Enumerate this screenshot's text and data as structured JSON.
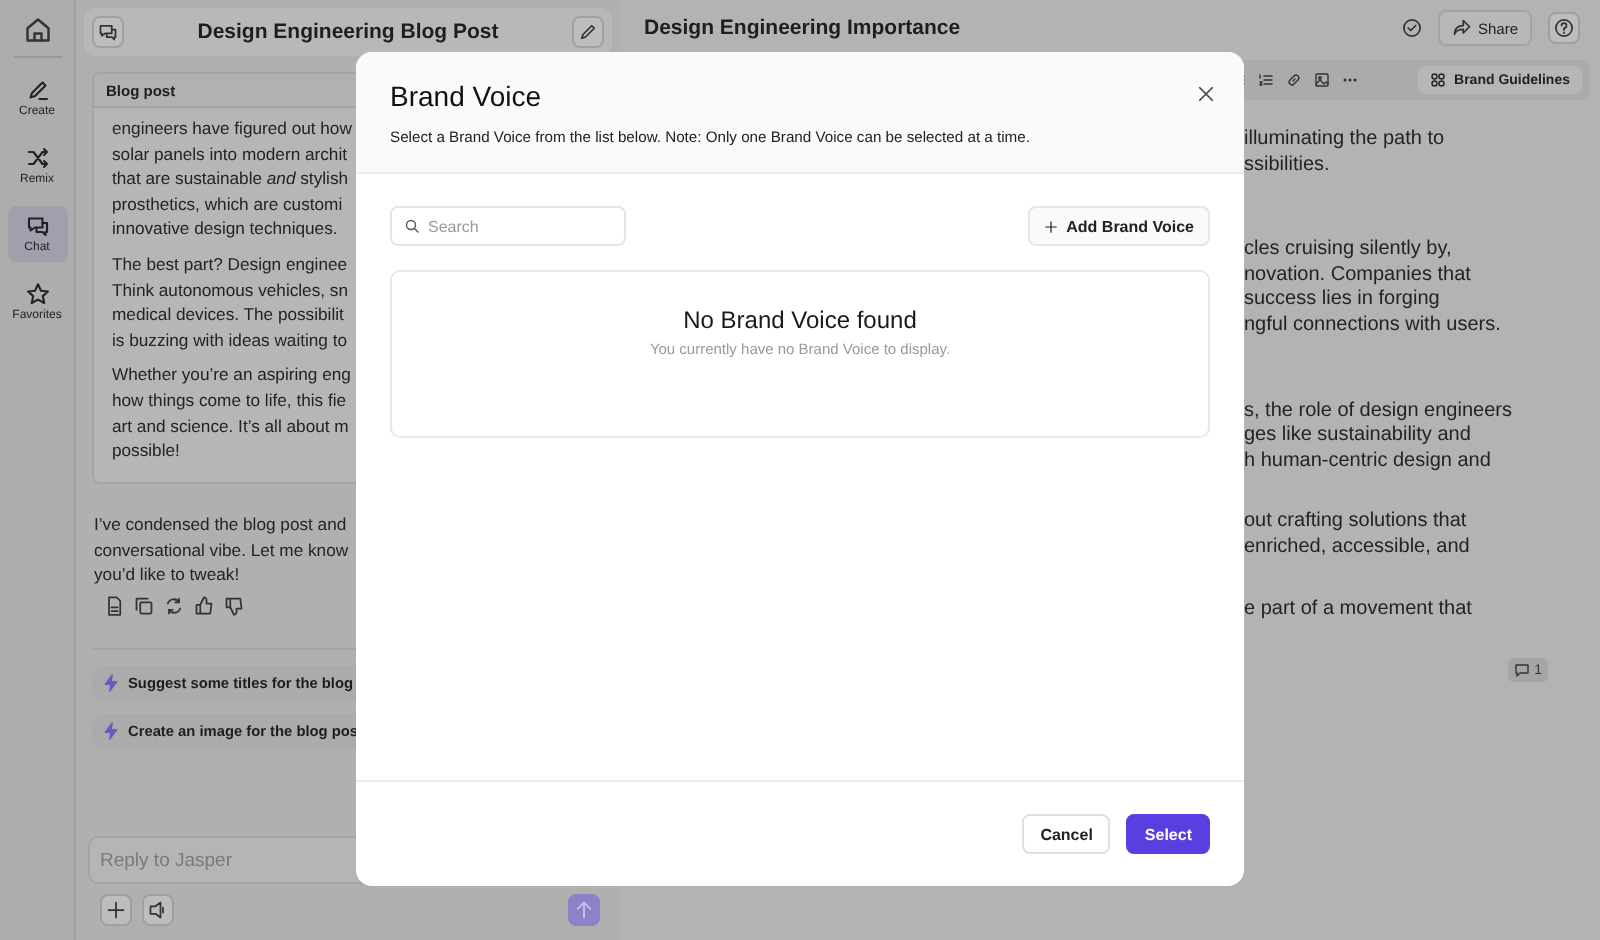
{
  "sidebar": {
    "items": [
      {
        "label": "Create",
        "selected": false
      },
      {
        "label": "Remix",
        "selected": false
      },
      {
        "label": "Chat",
        "selected": true
      },
      {
        "label": "Favorites",
        "selected": false
      }
    ]
  },
  "chat": {
    "title": "Design Engineering Blog Post",
    "card_label": "Blog post",
    "card_paragraphs": [
      [
        "engineers have figured out how",
        "solar panels into modern archit",
        "that are sustainable *and* stylish",
        "prosthetics, which are customi",
        "innovative design techniques."
      ],
      [
        "The best part? Design enginee",
        "Think autonomous vehicles, sn",
        "medical devices. The possibilit",
        "is buzzing with ideas waiting to"
      ],
      [
        "Whether you’re an aspiring eng",
        "how things come to life, this fie",
        "art and science. It’s all about m",
        "possible!"
      ]
    ],
    "reply_lines": [
      "I’ve condensed the blog post and",
      "conversational vibe. Let me know",
      "you’d like to tweak!"
    ],
    "suggestions": [
      "Suggest some titles for the blog",
      "Create an image for the blog pos"
    ],
    "input": {
      "placeholder": "Reply to Jasper"
    }
  },
  "document": {
    "title": "Design Engineering Importance",
    "share": "Share",
    "brand_guidelines": "Brand Guidelines",
    "paragraphs": [
      [
        "illuminating the path to",
        "ssibilities."
      ],
      [
        "cles cruising silently by,",
        "novation. Companies that",
        "success lies in forging",
        "ngful connections with users."
      ],
      [
        "s, the role of design engineers",
        "ges like sustainability and",
        "h human-centric design and"
      ],
      [
        "out crafting solutions that",
        "enriched, accessible, and"
      ],
      [
        "e part of a movement that"
      ]
    ],
    "comment_count": "1"
  },
  "modal": {
    "title": "Brand Voice",
    "subtitle": "Select a Brand Voice from the list below. Note: Only one Brand Voice can be selected at a time.",
    "search": {
      "placeholder": "Search"
    },
    "add_button": "Add Brand Voice",
    "empty_title": "No Brand Voice found",
    "empty_message": "You currently have no Brand Voice to display.",
    "buttons": [
      {
        "label": "Cancel",
        "kind": "secondary"
      },
      {
        "label": "Select",
        "kind": "primary"
      }
    ]
  }
}
